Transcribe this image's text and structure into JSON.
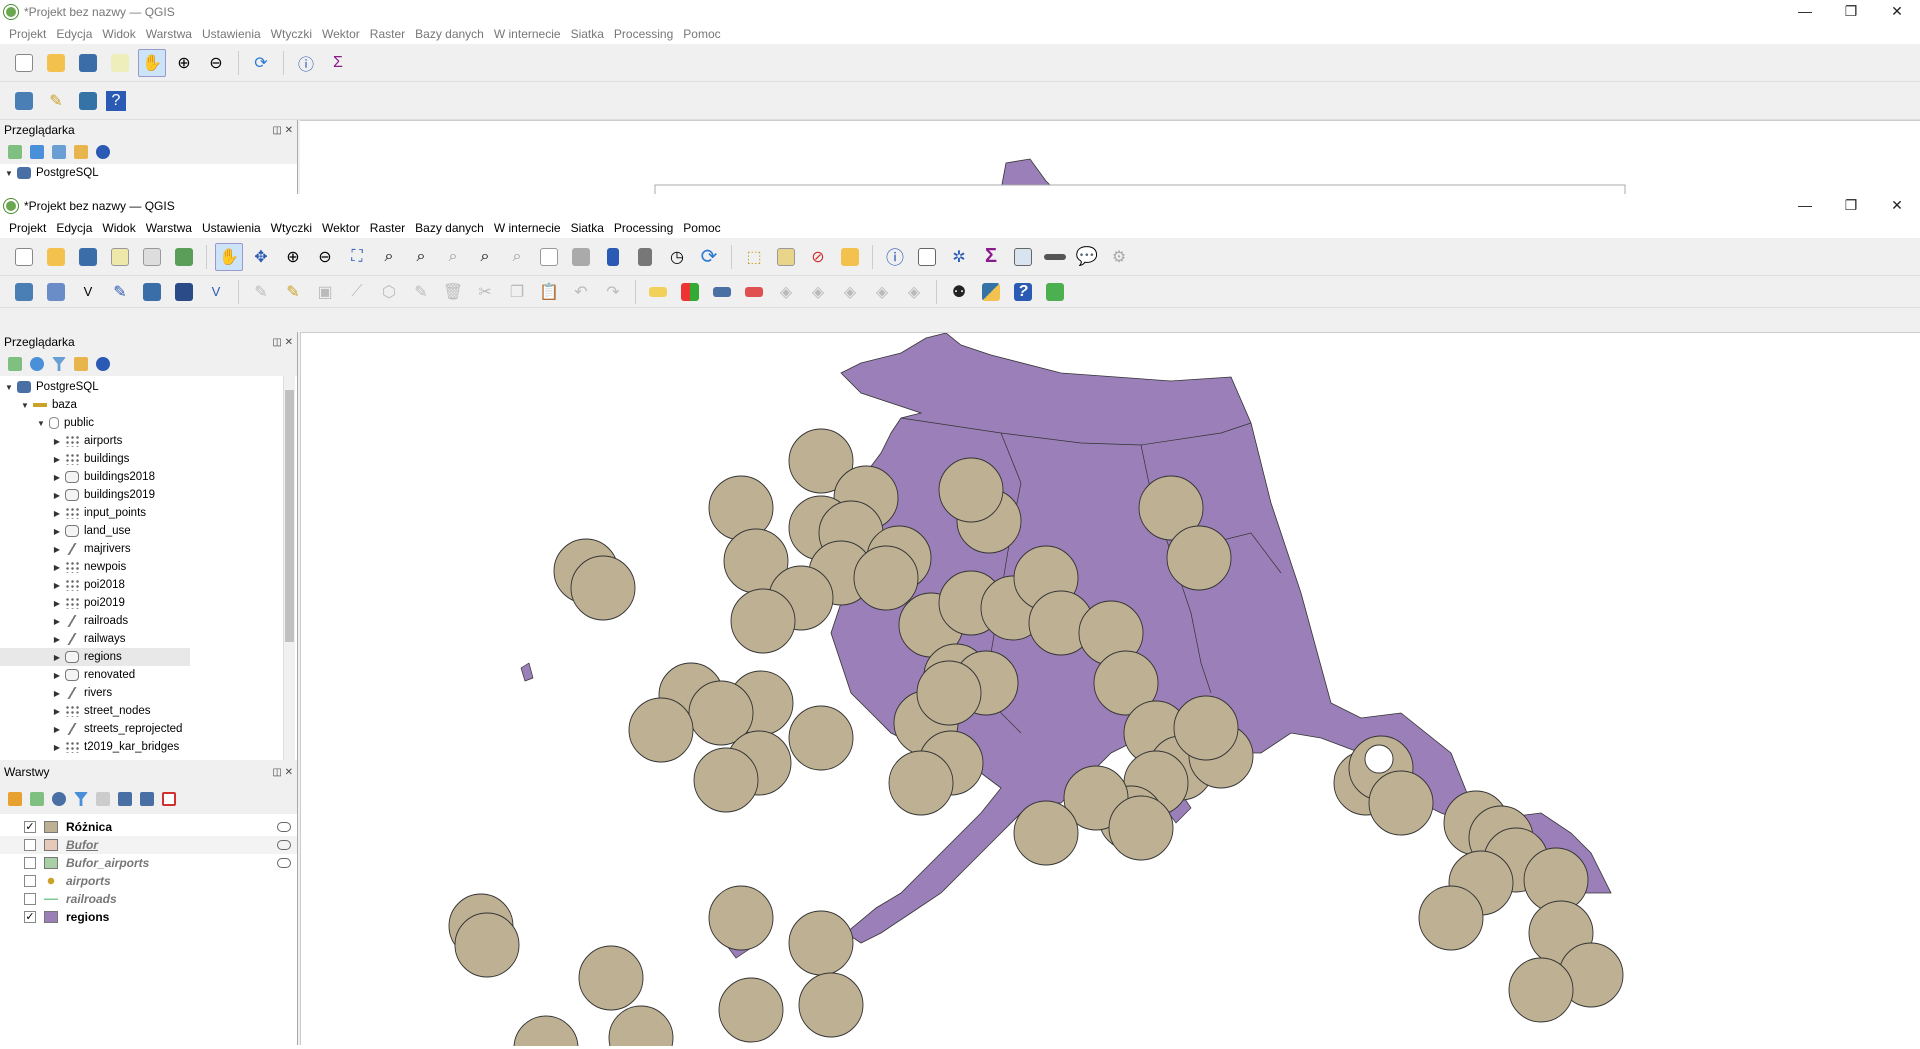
{
  "back_window": {
    "title": "*Projekt bez nazwy — QGIS",
    "menu": [
      "Projekt",
      "Edycja",
      "Widok",
      "Warstwa",
      "Ustawienia",
      "Wtyczki",
      "Wektor",
      "Raster",
      "Bazy danych",
      "W internecie",
      "Siatka",
      "Processing",
      "Pomoc"
    ],
    "browser_title": "Przeglądarka",
    "browser_first_item": "PostgreSQL"
  },
  "window": {
    "title": "*Projekt bez nazwy — QGIS",
    "controls": [
      "—",
      "❐",
      "✕"
    ],
    "menu": [
      "Projekt",
      "Edycja",
      "Widok",
      "Warstwa",
      "Ustawienia",
      "Wtyczki",
      "Wektor",
      "Raster",
      "Bazy danych",
      "W internecie",
      "Siatka",
      "Processing",
      "Pomoc"
    ]
  },
  "browser": {
    "title": "Przeglądarka",
    "root": "PostgreSQL",
    "connection": "baza",
    "schema": "public",
    "tables": [
      {
        "name": "airports",
        "type": "point"
      },
      {
        "name": "buildings",
        "type": "point"
      },
      {
        "name": "buildings2018",
        "type": "polygon"
      },
      {
        "name": "buildings2019",
        "type": "polygon"
      },
      {
        "name": "input_points",
        "type": "point"
      },
      {
        "name": "land_use",
        "type": "polygon"
      },
      {
        "name": "majrivers",
        "type": "line"
      },
      {
        "name": "newpois",
        "type": "point"
      },
      {
        "name": "poi2018",
        "type": "point"
      },
      {
        "name": "poi2019",
        "type": "point"
      },
      {
        "name": "railroads",
        "type": "line"
      },
      {
        "name": "railways",
        "type": "line"
      },
      {
        "name": "regions",
        "type": "polygon"
      },
      {
        "name": "renovated",
        "type": "polygon"
      },
      {
        "name": "rivers",
        "type": "line"
      },
      {
        "name": "street_nodes",
        "type": "point"
      },
      {
        "name": "streets_reprojected",
        "type": "line"
      },
      {
        "name": "t2019_kar_bridges",
        "type": "point"
      }
    ],
    "selected": "regions"
  },
  "layers": {
    "title": "Warstwy",
    "items": [
      {
        "name": "Różnica",
        "checked": true,
        "color": "#bdb093",
        "style": "bold",
        "filter": true
      },
      {
        "name": "Bufor",
        "checked": false,
        "color": "#e6c9b8",
        "style": "italic-link",
        "filter": true
      },
      {
        "name": "Bufor_airports",
        "checked": false,
        "color": "#a9cfa6",
        "style": "italic",
        "filter": true
      },
      {
        "name": "airports",
        "checked": false,
        "color": "#c9a227",
        "style": "italic",
        "filter": false
      },
      {
        "name": "railroads",
        "checked": false,
        "color": "#7ec89a",
        "style": "italic",
        "filter": false
      },
      {
        "name": "regions",
        "checked": true,
        "color": "#9b7fb8",
        "style": "bold",
        "filter": false
      }
    ]
  },
  "map": {
    "region_fill": "#9b7fb8",
    "buffer_fill": "#bdb093",
    "outline": "#333333"
  }
}
